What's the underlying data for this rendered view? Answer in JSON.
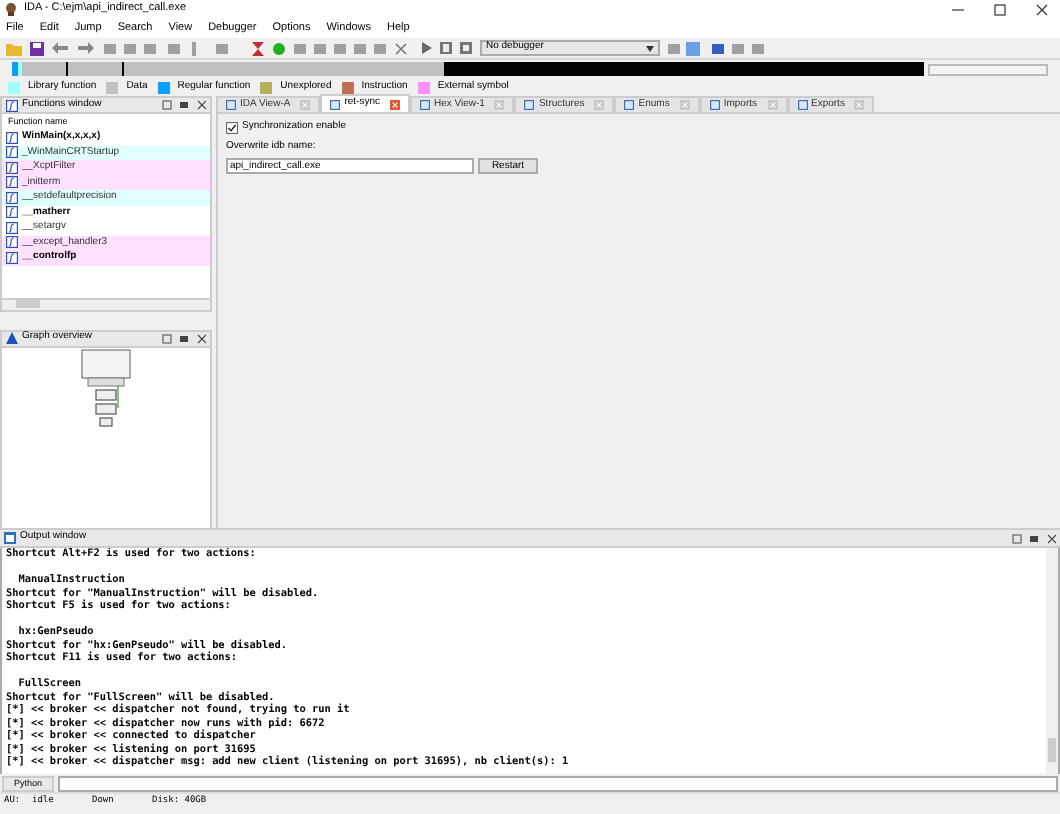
{
  "window": {
    "title": "IDA - C:\\ejm\\api_indirect_call.exe"
  },
  "menu": [
    "File",
    "Edit",
    "Jump",
    "Search",
    "View",
    "Debugger",
    "Options",
    "Windows",
    "Help"
  ],
  "debugger_select": {
    "value": "No debugger"
  },
  "legend": [
    {
      "label": "Library function",
      "color": "#a0ffff"
    },
    {
      "label": "Data",
      "color": "#c0c0c0"
    },
    {
      "label": "Regular function",
      "color": "#0aa0ff"
    },
    {
      "label": "Unexplored",
      "color": "#b0b060"
    },
    {
      "label": "Instruction",
      "color": "#c07050"
    },
    {
      "label": "External symbol",
      "color": "#ff90ff"
    }
  ],
  "functions_window": {
    "title": "Functions window",
    "column": "Function name",
    "rows": [
      {
        "name": "WinMain(x,x,x,x)",
        "color": "#ffffff",
        "bold": true
      },
      {
        "name": "_WinMainCRTStartup",
        "color": "#e0ffff",
        "bold": false
      },
      {
        "name": "__XcptFilter",
        "color": "#ffe0ff",
        "bold": false
      },
      {
        "name": "_initterm",
        "color": "#ffe0ff",
        "bold": false
      },
      {
        "name": "__setdefaultprecision",
        "color": "#e0ffff",
        "bold": false
      },
      {
        "name": "__matherr",
        "color": "#ffffff",
        "bold": true
      },
      {
        "name": "__setargv",
        "color": "#ffffff",
        "bold": false
      },
      {
        "name": "__except_handler3",
        "color": "#ffe0ff",
        "bold": false
      },
      {
        "name": "__controlfp",
        "color": "#ffe0ff",
        "bold": true
      }
    ]
  },
  "graph_overview": {
    "title": "Graph overview"
  },
  "tabs": [
    {
      "label": "IDA View-A",
      "selected": false
    },
    {
      "label": "ret-sync",
      "selected": true
    },
    {
      "label": "Hex View-1",
      "selected": false
    },
    {
      "label": "Structures",
      "selected": false
    },
    {
      "label": "Enums",
      "selected": false
    },
    {
      "label": "Imports",
      "selected": false
    },
    {
      "label": "Exports",
      "selected": false
    }
  ],
  "sync_panel": {
    "checkbox": {
      "label": "Synchronization enable",
      "checked": true
    },
    "idb_label": "Overwrite idb name:",
    "idb_value": "api_indirect_call.exe",
    "button": "Restart"
  },
  "output_window": {
    "title": "Output window",
    "lines": [
      [
        "Shortcut Alt+F2 is used for two actions:"
      ],
      [
        "  ManualInstruction",
        "Shortcut for \"ManualInstruction\" will be disabled.",
        "Shortcut F5 is used for two actions:"
      ],
      [
        "  hx:GenPseudo",
        "Shortcut for \"hx:GenPseudo\" will be disabled.",
        "Shortcut F11 is used for two actions:"
      ],
      [
        "  FullScreen",
        "Shortcut for \"FullScreen\" will be disabled.",
        "[*] << broker << dispatcher not found, trying to run it",
        "[*] << broker << dispatcher now runs with pid: 6672",
        "[*] << broker << connected to dispatcher",
        "[*] << broker << listening on port 31695",
        "[*] << broker << dispatcher msg: add new client (listening on port 31695), nb client(s): 1"
      ]
    ]
  },
  "command_bar": {
    "button": "Python"
  },
  "status_bar": [
    "AU:",
    "idle",
    "Down",
    "Disk: 40GB"
  ]
}
